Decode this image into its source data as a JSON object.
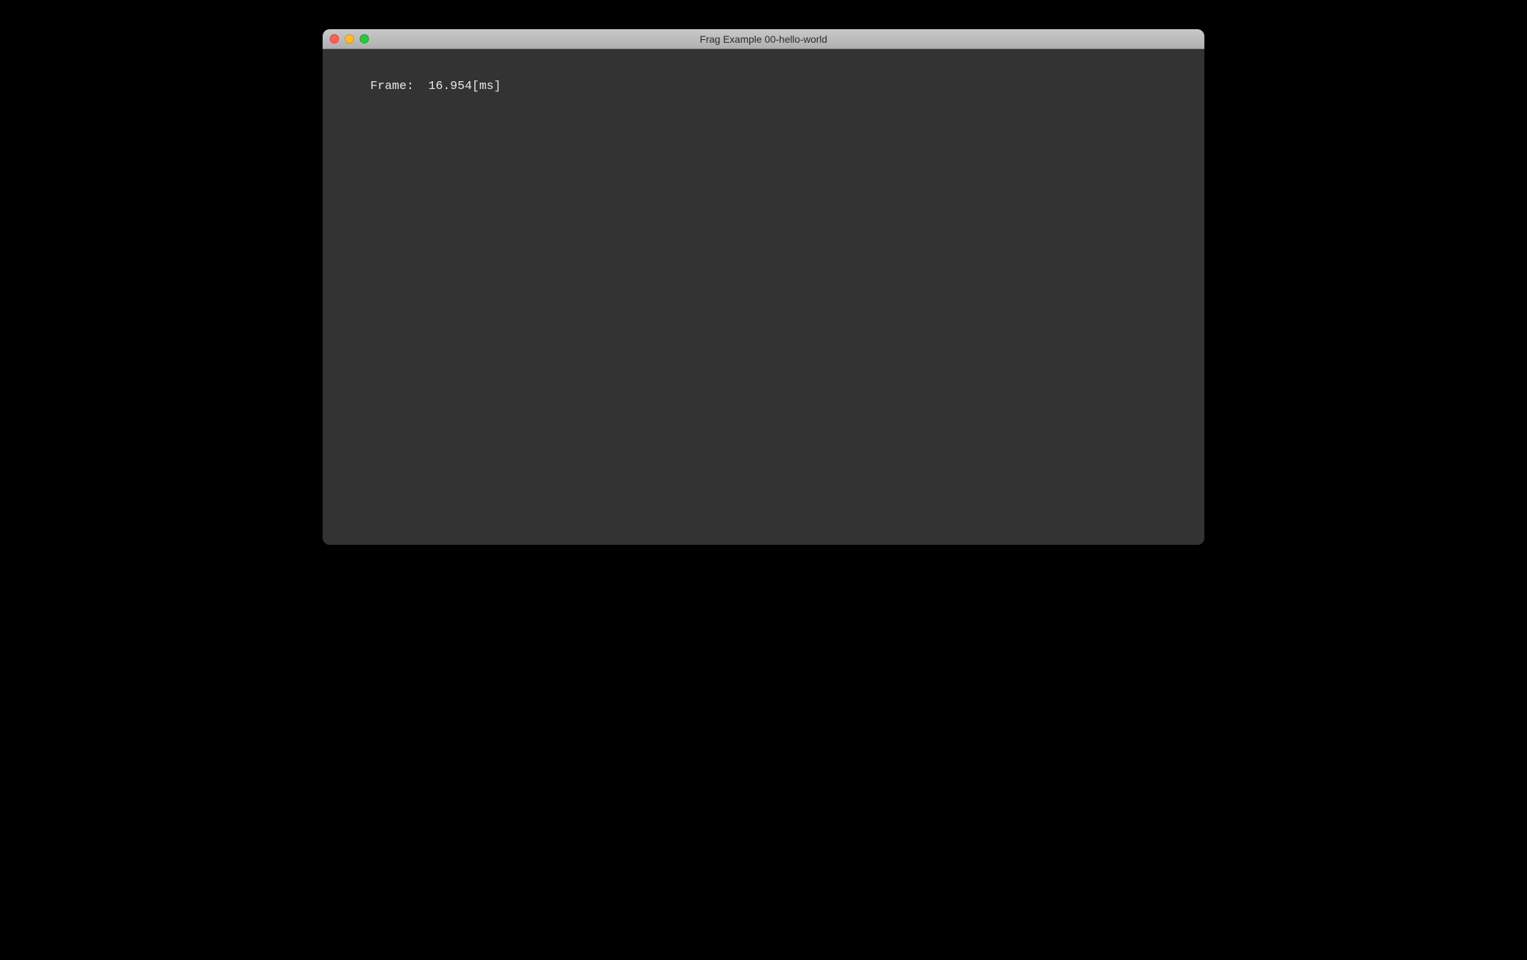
{
  "window": {
    "title": "Frag Example 00-hello-world"
  },
  "debug": {
    "frame_label": "Frame:",
    "frame_value": "16.954",
    "frame_unit": "[ms]"
  }
}
